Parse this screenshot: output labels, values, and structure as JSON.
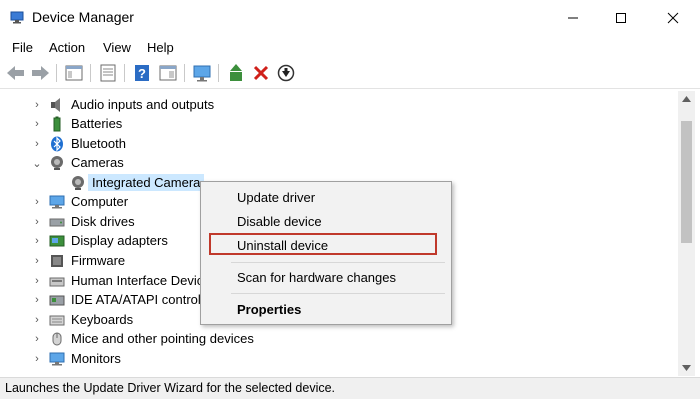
{
  "window": {
    "title": "Device Manager"
  },
  "menu": [
    "File",
    "Action",
    "View",
    "Help"
  ],
  "toolbar": {
    "buttons": [
      "back-icon",
      "forward-icon",
      "show-hide-tree-icon",
      "properties-icon",
      "help-icon",
      "view-icon",
      "scan-hardware-icon",
      "update-driver-icon",
      "uninstall-icon",
      "disable-icon"
    ]
  },
  "tree": {
    "items": [
      {
        "label": "Audio inputs and outputs",
        "icon": "speaker-icon",
        "expanded": false
      },
      {
        "label": "Batteries",
        "icon": "battery-icon",
        "expanded": false
      },
      {
        "label": "Bluetooth",
        "icon": "bluetooth-icon",
        "expanded": false
      },
      {
        "label": "Cameras",
        "icon": "camera-icon",
        "expanded": true
      },
      {
        "label": "Integrated Camera",
        "icon": "webcam-icon",
        "selected": true
      },
      {
        "label": "Computer",
        "icon": "computer-icon",
        "expanded": false
      },
      {
        "label": "Disk drives",
        "icon": "disk-icon",
        "expanded": false
      },
      {
        "label": "Display adapters",
        "icon": "display-adapter-icon",
        "expanded": false
      },
      {
        "label": "Firmware",
        "icon": "firmware-icon",
        "expanded": false
      },
      {
        "label": "Human Interface Devic",
        "icon": "hid-icon",
        "expanded": false
      },
      {
        "label": "IDE ATA/ATAPI controlle",
        "icon": "ide-icon",
        "expanded": false
      },
      {
        "label": "Keyboards",
        "icon": "keyboard-icon",
        "expanded": false
      },
      {
        "label": "Mice and other pointing devices",
        "icon": "mouse-icon",
        "expanded": false
      },
      {
        "label": "Monitors",
        "icon": "monitor-icon",
        "expanded": false
      }
    ]
  },
  "context_menu": {
    "items": [
      "Update driver",
      "Disable device",
      "Uninstall device",
      "Scan for hardware changes",
      "Properties"
    ],
    "highlighted": "Uninstall device"
  },
  "status": {
    "text": "Launches the Update Driver Wizard for the selected device."
  },
  "colors": {
    "selection": "#cce8ff",
    "highlight_border": "#c0392b"
  }
}
